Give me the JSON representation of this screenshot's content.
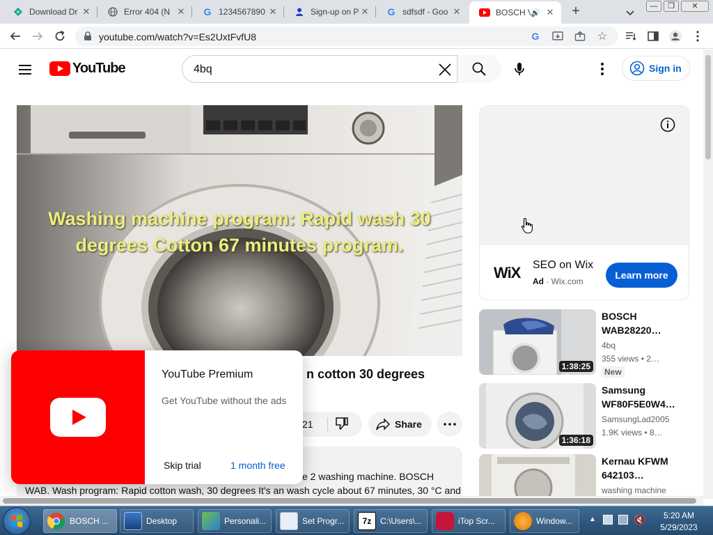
{
  "browser": {
    "tabs": [
      {
        "title": "Download Dr",
        "icon": "green-diamond-icon"
      },
      {
        "title": "Error 404 (N",
        "icon": "globe-icon"
      },
      {
        "title": "1234567890",
        "icon": "google-icon"
      },
      {
        "title": "Sign-up on P",
        "icon": "person-icon"
      },
      {
        "title": "sdfsdf - Goo",
        "icon": "google-icon"
      },
      {
        "title": "BOSCH V",
        "icon": "youtube-icon",
        "active": true
      }
    ],
    "url": "youtube.com/watch?v=Es2UxtFvfU8"
  },
  "youtube": {
    "logo_text": "YouTube",
    "search": {
      "value": "4bq"
    },
    "signin_label": "Sign in"
  },
  "player": {
    "caption_line1": "Washing machine program: Rapid wash 30",
    "caption_line2": "degrees Cotton 67 minutes program."
  },
  "video": {
    "title_fragment": "n cotton 30 degrees",
    "like_count_fragment": "21",
    "share_label": "Share",
    "description_line1": "e 2 washing machine. BOSCH",
    "description_line2": "WAB. Wash program: Rapid cotton wash, 30 degrees It's an wash cycle about 67 minutes, 30 °C and"
  },
  "ad": {
    "logo": "WiX",
    "title": "SEO on Wix",
    "ad_label": "Ad",
    "domain": "· Wix.com",
    "cta": "Learn more"
  },
  "related": [
    {
      "title_line1": "BOSCH",
      "title_line2": "WAB28220…",
      "channel": "4bq",
      "meta": "355 views • 2…",
      "badge": "New",
      "duration": "1:38:25"
    },
    {
      "title_line1": "Samsung",
      "title_line2": "WF80F5E0W4…",
      "channel": "SamsungLad2005",
      "meta": "1.9K views • 8…",
      "duration": "1:36:18"
    },
    {
      "title_line1": "Kernau KFWM",
      "title_line2": "642103…",
      "channel": "washing machine"
    }
  ],
  "premium_popup": {
    "title": "YouTube Premium",
    "subtitle": "Get YouTube without the ads",
    "skip_label": "Skip trial",
    "cta_label": "1 month free"
  },
  "taskbar": {
    "items": [
      {
        "label": "BOSCH ...",
        "icon": "chrome-icon",
        "active": true
      },
      {
        "label": "Desktop",
        "icon": "desktop-icon"
      },
      {
        "label": "Personali...",
        "icon": "personalize-icon"
      },
      {
        "label": "Set Progr...",
        "icon": "set-programs-icon"
      },
      {
        "label": "C:\\Users\\...",
        "icon": "7zip-icon"
      },
      {
        "label": "iTop Scr...",
        "icon": "itop-recorder-icon"
      },
      {
        "label": "Window...",
        "icon": "media-player-icon"
      }
    ],
    "time": "5:20 AM",
    "date": "5/29/2023"
  },
  "colors": {
    "youtube_red": "#ff0000",
    "link_blue": "#065fd4",
    "caption_yellow": "#eeee7a"
  }
}
